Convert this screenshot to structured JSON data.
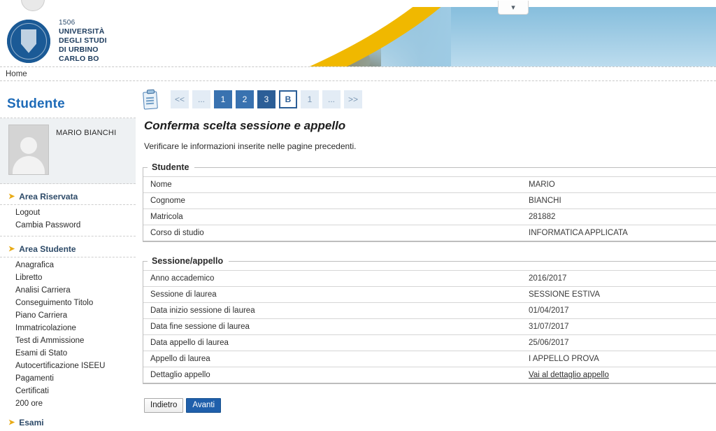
{
  "banner": {
    "logo_year": "1506",
    "logo_lines": [
      "UNIVERSITÀ",
      "DEGLI STUDI",
      "DI URBINO",
      "CARLO BO"
    ],
    "collapse_icon": "chevron-down-icon",
    "colors": {
      "swoosh": "#f0b800",
      "sky": "#9ecbe4",
      "seal": "#1b5a96"
    }
  },
  "breadcrumb": {
    "home": "Home"
  },
  "sidebar": {
    "title": "Studente",
    "user_name": "MARIO BIANCHI",
    "groups": [
      {
        "label": "Area Riservata",
        "items": [
          {
            "label": "Logout"
          },
          {
            "label": "Cambia Password"
          }
        ]
      },
      {
        "label": "Area Studente",
        "items": [
          {
            "label": "Anagrafica"
          },
          {
            "label": "Libretto"
          },
          {
            "label": "Analisi Carriera"
          },
          {
            "label": "Conseguimento Titolo"
          },
          {
            "label": "Piano Carriera"
          },
          {
            "label": "Immatricolazione"
          },
          {
            "label": "Test di Ammissione"
          },
          {
            "label": "Esami di Stato"
          },
          {
            "label": "Autocertificazione ISEEU"
          },
          {
            "label": "Pagamenti"
          },
          {
            "label": "Certificati"
          },
          {
            "label": "200 ore"
          }
        ]
      },
      {
        "label": "Esami",
        "items": []
      }
    ]
  },
  "main": {
    "wizard_icon": "clipboard-checklist-icon",
    "pager": [
      {
        "label": "<<",
        "style": "muted",
        "name": "pager-first"
      },
      {
        "label": "...",
        "style": "muted",
        "name": "pager-ellipsis-left"
      },
      {
        "label": "1",
        "style": "filled",
        "name": "pager-step-1"
      },
      {
        "label": "2",
        "style": "filled",
        "name": "pager-step-2"
      },
      {
        "label": "3",
        "style": "filled-dark",
        "name": "pager-step-3"
      },
      {
        "label": "B",
        "style": "current",
        "name": "pager-step-b"
      },
      {
        "label": "1",
        "style": "muted",
        "name": "pager-step-next-1"
      },
      {
        "label": "...",
        "style": "muted",
        "name": "pager-ellipsis-right"
      },
      {
        "label": ">>",
        "style": "muted",
        "name": "pager-last"
      }
    ],
    "title": "Conferma scelta sessione e appello",
    "intro": "Verificare le informazioni inserite nelle pagine precedenti.",
    "panels": [
      {
        "legend": "Studente",
        "rows": [
          {
            "key": "Nome",
            "value": "MARIO"
          },
          {
            "key": "Cognome",
            "value": "BIANCHI"
          },
          {
            "key": "Matricola",
            "value": "281882"
          },
          {
            "key": "Corso di studio",
            "value": "INFORMATICA APPLICATA"
          }
        ]
      },
      {
        "legend": "Sessione/appello",
        "rows": [
          {
            "key": "Anno accademico",
            "value": "2016/2017"
          },
          {
            "key": "Sessione di laurea",
            "value": "SESSIONE ESTIVA"
          },
          {
            "key": "Data inizio sessione di laurea",
            "value": "01/04/2017"
          },
          {
            "key": "Data fine sessione di laurea",
            "value": "31/07/2017"
          },
          {
            "key": "Data appello di laurea",
            "value": "25/06/2017"
          },
          {
            "key": "Appello di laurea",
            "value": "I APPELLO PROVA"
          },
          {
            "key": "Dettaglio appello",
            "value": "Vai al dettaglio appello",
            "link": true
          }
        ]
      }
    ],
    "buttons": {
      "back": "Indietro",
      "next": "Avanti"
    }
  }
}
